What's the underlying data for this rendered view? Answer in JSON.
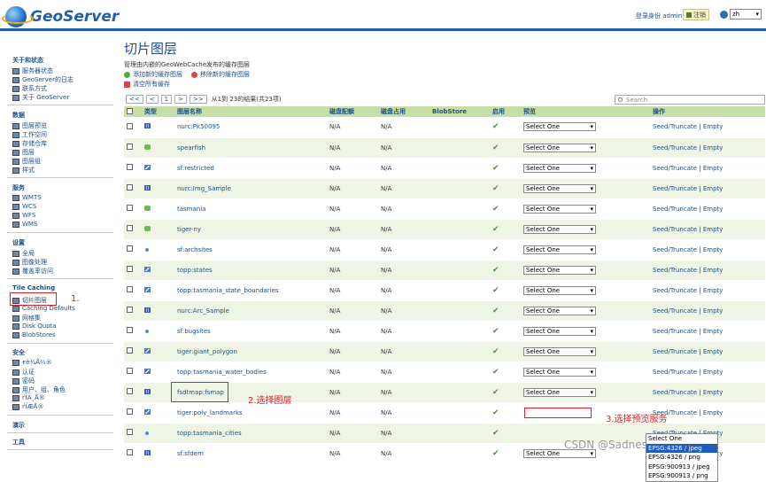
{
  "header": {
    "app_name": "GeoServer",
    "login_status": "登录身份 admin.",
    "logout_label": "注销",
    "language": "zh"
  },
  "sidebar": {
    "sections": [
      {
        "title": "关于和状态",
        "items": [
          "服务器状态",
          "GeoServer的日志",
          "联系方式",
          "关于 GeoServer"
        ]
      },
      {
        "title": "数据",
        "items": [
          "图层预览",
          "工作空间",
          "存储仓库",
          "图层",
          "图层组",
          "样式"
        ]
      },
      {
        "title": "服务",
        "items": [
          "WMTS",
          "WCS",
          "WFS",
          "WMS"
        ]
      },
      {
        "title": "设置",
        "items": [
          "全局",
          "图像处理",
          "覆盖率访问"
        ]
      },
      {
        "title": "Tile Caching",
        "items": [
          "切片图层",
          "Caching Defaults",
          "网格集",
          "Disk Quota",
          "BlobStores"
        ]
      },
      {
        "title": "安全",
        "items": [
          "ғé¾Å½®",
          "认证",
          "密码",
          "用户、组、角色",
          "ѓÏÄ¸Å®",
          "ѓÏÆÅ®"
        ]
      },
      {
        "title": "演示",
        "items": []
      },
      {
        "title": "工具",
        "items": []
      }
    ]
  },
  "main": {
    "title": "切片图层",
    "description": "管理由内嵌的GeoWebCache发布的缓存图层",
    "actions": {
      "add": "添加新的缓存图层",
      "remove": "移除新的缓存图层",
      "clear": "清空所有缓存"
    },
    "pager": {
      "first": "<<",
      "prev": "<",
      "page": "1",
      "next": ">",
      "last": ">>",
      "info": "从1到 23的结果(共23项)"
    },
    "search_placeholder": "Search",
    "columns": [
      "类型",
      "图层名称",
      "磁盘配额",
      "磁盘占用",
      "BlobStore",
      "启用",
      "预览",
      "操作"
    ],
    "rows": [
      {
        "type": "grid",
        "name": "nurc:Pk50095",
        "quota": "N/A",
        "usage": "N/A",
        "preview": "Select One",
        "ops": "Seed/Truncate",
        "empty": "Empty"
      },
      {
        "type": "poly",
        "name": "spearfish",
        "quota": "N/A",
        "usage": "N/A",
        "preview": "Select One",
        "ops": "Seed/Truncate",
        "empty": "Empty"
      },
      {
        "type": "line",
        "name": "sf:restricted",
        "quota": "N/A",
        "usage": "N/A",
        "preview": "Select One",
        "ops": "Seed/Truncate",
        "empty": "Empty"
      },
      {
        "type": "grid",
        "name": "nurc:Img_Sample",
        "quota": "N/A",
        "usage": "N/A",
        "preview": "Select One",
        "ops": "Seed/Truncate",
        "empty": "Empty"
      },
      {
        "type": "poly",
        "name": "tasmania",
        "quota": "N/A",
        "usage": "N/A",
        "preview": "Select One",
        "ops": "Seed/Truncate",
        "empty": "Empty"
      },
      {
        "type": "poly",
        "name": "tiger-ny",
        "quota": "N/A",
        "usage": "N/A",
        "preview": "Select One",
        "ops": "Seed/Truncate",
        "empty": "Empty"
      },
      {
        "type": "point",
        "name": "sf:archsites",
        "quota": "N/A",
        "usage": "N/A",
        "preview": "Select One",
        "ops": "Seed/Truncate",
        "empty": "Empty"
      },
      {
        "type": "line",
        "name": "topp:states",
        "quota": "N/A",
        "usage": "N/A",
        "preview": "Select One",
        "ops": "Seed/Truncate",
        "empty": "Empty"
      },
      {
        "type": "line",
        "name": "topp:tasmania_state_boundaries",
        "quota": "N/A",
        "usage": "N/A",
        "preview": "Select One",
        "ops": "Seed/Truncate",
        "empty": "Empty"
      },
      {
        "type": "grid",
        "name": "nurc:Arc_Sample",
        "quota": "N/A",
        "usage": "N/A",
        "preview": "Select One",
        "ops": "Seed/Truncate",
        "empty": "Empty"
      },
      {
        "type": "point",
        "name": "sf:bugsites",
        "quota": "N/A",
        "usage": "N/A",
        "preview": "Select One",
        "ops": "Seed/Truncate",
        "empty": "Empty"
      },
      {
        "type": "line",
        "name": "tiger:giant_polygon",
        "quota": "N/A",
        "usage": "N/A",
        "preview": "Select One",
        "ops": "Seed/Truncate",
        "empty": "Empty"
      },
      {
        "type": "line",
        "name": "topp:tasmania_water_bodies",
        "quota": "N/A",
        "usage": "N/A",
        "preview": "Select One",
        "ops": "Seed/Truncate",
        "empty": "Empty"
      },
      {
        "type": "grid",
        "name": "fsdtmap:fsmap",
        "quota": "N/A",
        "usage": "N/A",
        "preview": "Select One",
        "ops": "Seed/Truncate",
        "empty": "Empty"
      },
      {
        "type": "line",
        "name": "tiger:poly_landmarks",
        "quota": "N/A",
        "usage": "N/A",
        "preview": "",
        "ops": "Seed/Truncate",
        "empty": "Empty"
      },
      {
        "type": "point",
        "name": "topp:tasmania_cities",
        "quota": "N/A",
        "usage": "N/A",
        "preview": "",
        "ops": "Seed/Truncate",
        "empty": "Empty"
      },
      {
        "type": "grid",
        "name": "sf:sfdem",
        "quota": "N/A",
        "usage": "N/A",
        "preview": "Select One",
        "ops": "Seed/Truncate",
        "empty": "Empty"
      }
    ],
    "dropdown_options": [
      "Select One",
      "EPSG:4326 / jpeg",
      "EPSG:4326 / png",
      "EPSG:900913 / jpeg",
      "EPSG:900913 / png"
    ]
  },
  "annotations": {
    "step1": "1.",
    "step2": "2.选择图层",
    "step3": "3.选择预览服务"
  },
  "watermark": "CSDN @SadnessLayTime",
  "colors": {
    "brand": "#1f5fa8",
    "table_header": "#c8dea7",
    "row_alt": "#eef5e4",
    "annotation_red": "#e02020",
    "enabled_check": "#3a9a2a"
  }
}
